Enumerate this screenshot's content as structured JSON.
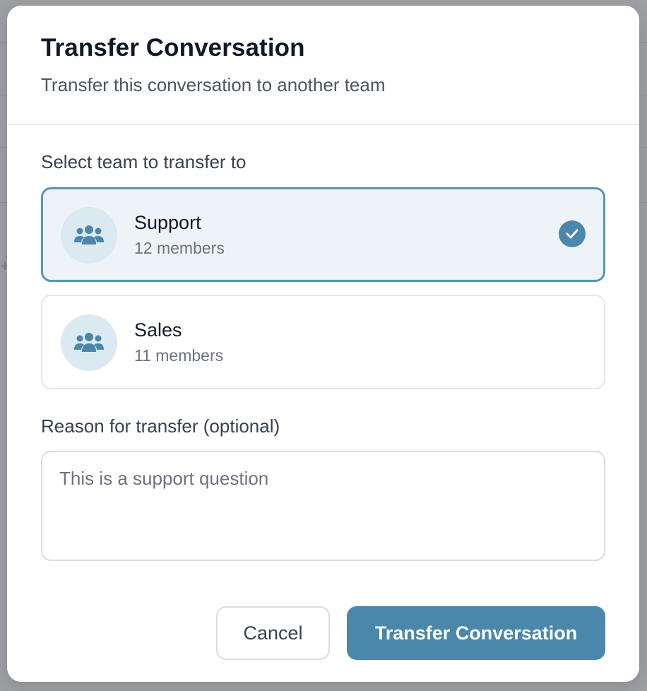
{
  "modal": {
    "title": "Transfer Conversation",
    "subtitle": "Transfer this conversation to another team"
  },
  "team_select": {
    "label": "Select team to transfer to",
    "teams": [
      {
        "name": "Support",
        "members": "12 members",
        "selected": true,
        "icon": "users-group-icon"
      },
      {
        "name": "Sales",
        "members": "11 members",
        "selected": false,
        "icon": "users-group-icon"
      }
    ]
  },
  "reason": {
    "label": "Reason for transfer (optional)",
    "placeholder": "This is a support question",
    "value": ""
  },
  "actions": {
    "cancel_label": "Cancel",
    "submit_label": "Transfer Conversation"
  },
  "colors": {
    "accent": "#4a87ab",
    "selected_bg": "#edf3f7",
    "selected_border": "#5a95b8",
    "avatar_bg": "#dbe9f0",
    "overlay": "#9d9fa3"
  }
}
